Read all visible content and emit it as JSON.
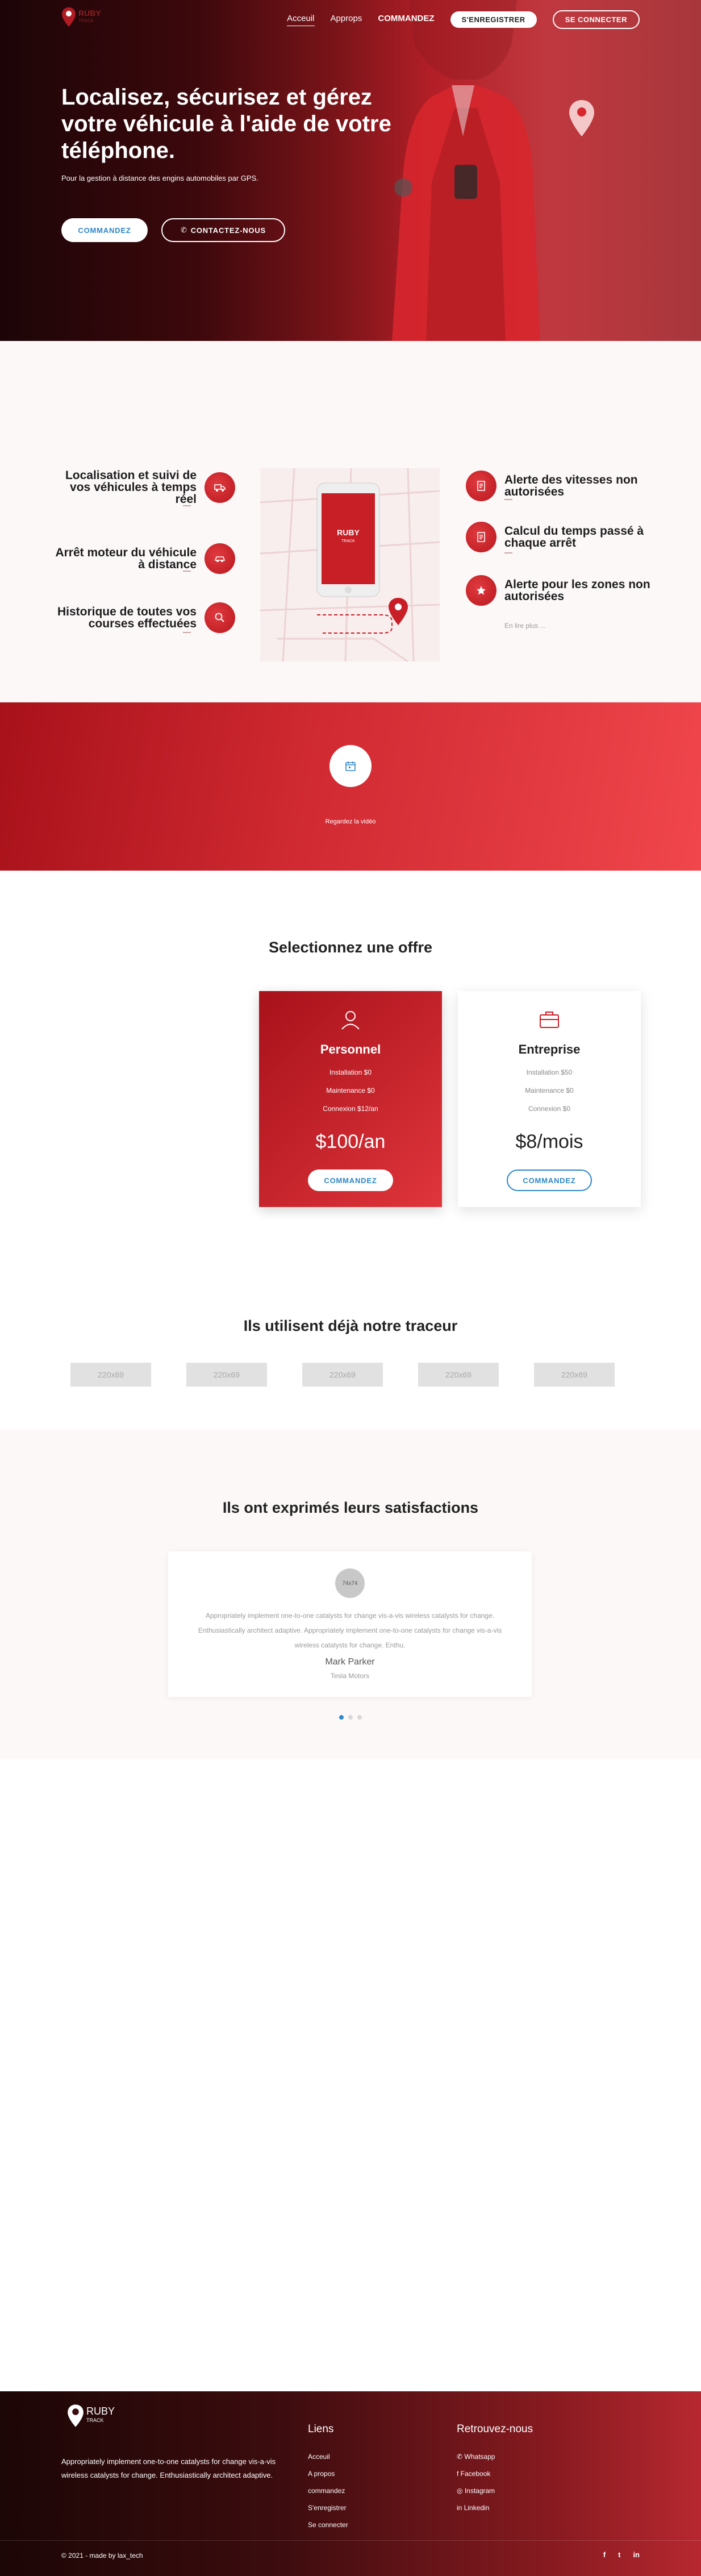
{
  "nav": {
    "logo_text": "RUBY",
    "logo_sub": "TRACK",
    "links": [
      "Acceuil",
      "Approps",
      "COMMANDEZ"
    ],
    "register": "S'ENREGISTRER",
    "login": "SE CONNECTER"
  },
  "hero": {
    "title": "Localisez, sécurisez et gérez votre véhicule à l'aide de votre téléphone.",
    "subtitle": "Pour la gestion à distance des engins automobiles par GPS.",
    "btn_order": "COMMANDEZ",
    "btn_contact": "CONTACTEZ-NOUS"
  },
  "features": {
    "left": [
      "Localisation et suivi de vos véhicules à temps réel",
      "Arrêt moteur du véhicule à distance",
      "Historique de toutes vos courses effectuées"
    ],
    "right": [
      "Alerte des vitesses non autorisées",
      "Calcul du temps passé à chaque arrêt",
      "Alerte pour les zones non autorisées"
    ],
    "read_more": "En lire plus ...",
    "phone_logo": "RUBY",
    "phone_sub": "TRACK"
  },
  "video": {
    "label": "Regardez la vidéo"
  },
  "offers": {
    "title": "Selectionnez une offre",
    "items": [
      {
        "name": "Personnel",
        "features": [
          "Installation $0",
          "Maintenance $0",
          "Connexion $12/an"
        ],
        "price": "$100/an",
        "button": "COMMANDEZ"
      },
      {
        "name": "Entreprise",
        "features": [
          "Installation $50",
          "Maintenance $0",
          "Connexion $0"
        ],
        "price": "$8/mois",
        "button": "COMMANDEZ"
      }
    ]
  },
  "clients": {
    "title": "Ils utilisent déjà notre traceur",
    "placeholders": [
      "220x69",
      "220x69",
      "220x69",
      "220x69",
      "220x69"
    ]
  },
  "testimonials": {
    "title": "Ils ont exprimés leurs satisfactions",
    "avatar": "74x74",
    "quote": "Appropriately implement one-to-one catalysts for change vis-a-vis wireless catalysts for change. Enthusiastically architect adaptive. Appropriately implement one-to-one catalysts for change vis-a-vis wireless catalysts for change. Enthu.",
    "name": "Mark Parker",
    "role": "Tesla Motors"
  },
  "footer": {
    "logo_text": "RUBY",
    "logo_sub": "TRACK",
    "description": "Appropriately implement one-to-one catalysts for change vis-a-vis wireless catalysts for change. Enthusiastically architect adaptive.",
    "links_title": "Liens",
    "links": [
      "Acceuil",
      "A propos",
      "commandez",
      "S'enregistrer",
      "Se connecter"
    ],
    "social_title": "Retrouvez-nous",
    "social": [
      "Whatsapp",
      "Facebook",
      "Instagram",
      "Linkedin"
    ],
    "copyright": "© 2021 - made by lax_tech",
    "icons": [
      "f",
      "t",
      "in"
    ]
  },
  "colors": {
    "brand_red": "#d12a32",
    "link_blue": "#2e87c9",
    "dark": "#1c0507"
  }
}
